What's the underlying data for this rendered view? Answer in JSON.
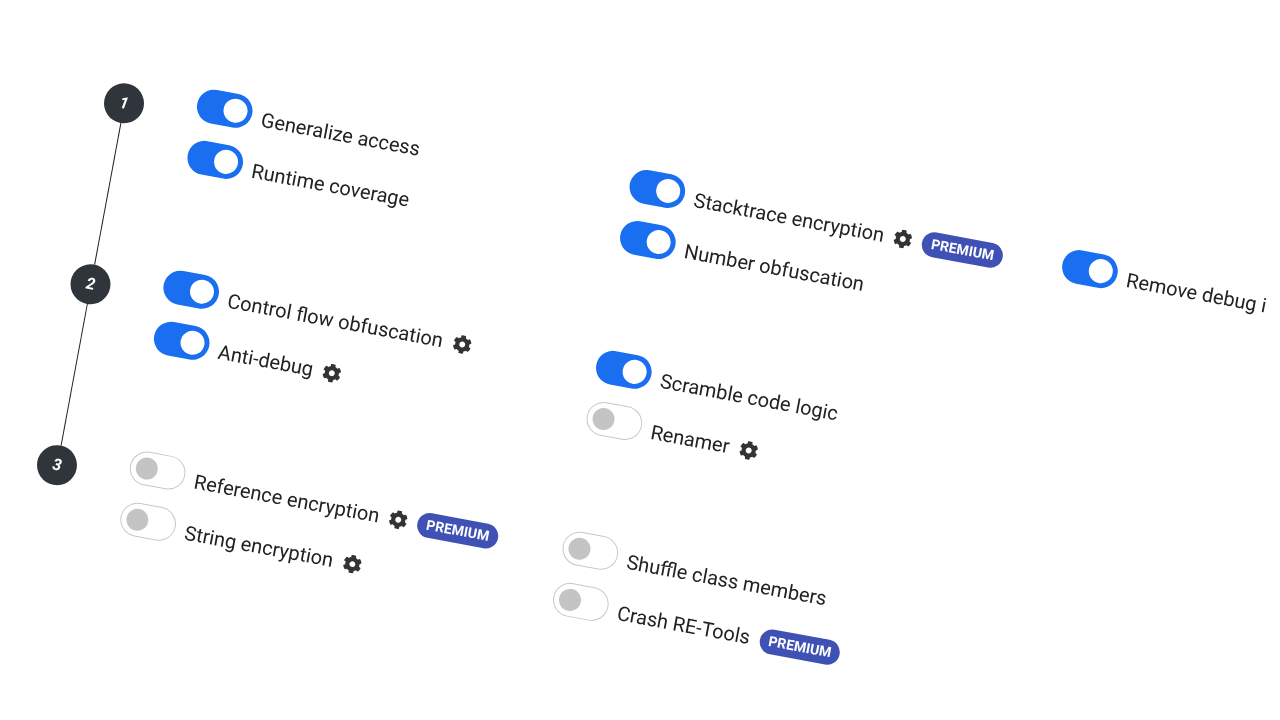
{
  "steps": [
    {
      "number": "1",
      "columns": [
        [
          {
            "label": "Generalize access",
            "on": true,
            "settings": false
          },
          {
            "label": "Runtime coverage",
            "on": true,
            "settings": false
          }
        ],
        [
          {
            "label": "Stacktrace encryption",
            "on": true,
            "settings": true,
            "badge": "PREMIUM"
          },
          {
            "label": "Number obfuscation",
            "on": true,
            "settings": false
          }
        ],
        [
          {
            "label": "Remove debug i",
            "on": true,
            "settings": false
          }
        ]
      ]
    },
    {
      "number": "2",
      "columns": [
        [
          {
            "label": "Control flow obfuscation",
            "on": true,
            "settings": true
          },
          {
            "label": "Anti-debug",
            "on": true,
            "settings": true
          }
        ],
        [
          {
            "label": "Scramble code logic",
            "on": true,
            "settings": false
          },
          {
            "label": "Renamer",
            "on": false,
            "settings": true
          }
        ]
      ]
    },
    {
      "number": "3",
      "columns": [
        [
          {
            "label": "Reference encryption",
            "on": false,
            "settings": true,
            "badge": "PREMIUM"
          },
          {
            "label": "String encryption",
            "on": false,
            "settings": true
          }
        ],
        [
          {
            "label": "Shuffle class members",
            "on": false,
            "settings": false
          },
          {
            "label": "Crash RE-Tools",
            "on": false,
            "settings": false,
            "badge": "PREMIUM"
          }
        ]
      ]
    }
  ]
}
